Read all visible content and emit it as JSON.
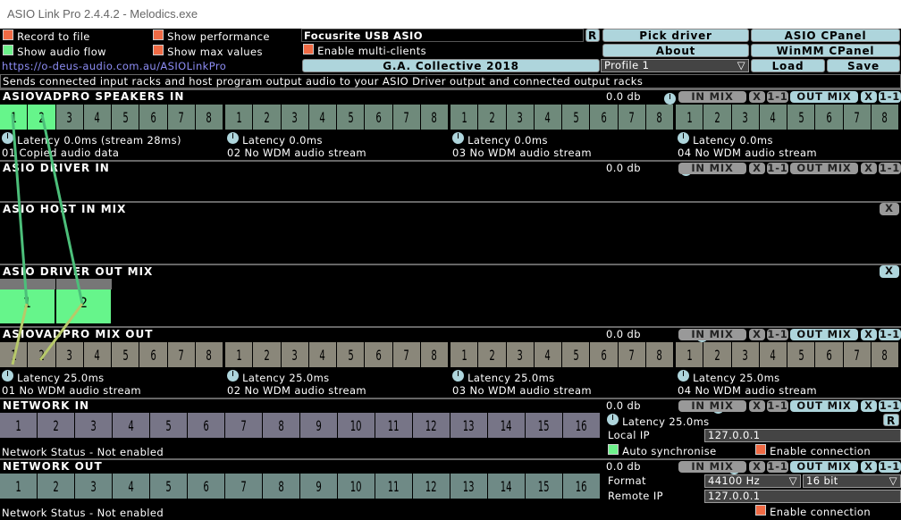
{
  "window": {
    "title": "ASIO Link Pro 2.4.4.2 - Melodics.exe"
  },
  "top": {
    "record_to_file": {
      "label": "Record to file",
      "checked": false
    },
    "show_audio_flow": {
      "label": "Show audio flow",
      "checked": true
    },
    "show_performance": {
      "label": "Show performance",
      "checked": false
    },
    "show_max_values": {
      "label": "Show max values",
      "checked": false
    },
    "link": "https://o-deus-audio.com.au/ASIOLinkPro",
    "driver_name": "Focusrite USB ASIO",
    "reset_label": "R",
    "enable_multi_clients": {
      "label": "Enable multi-clients",
      "checked": false
    },
    "license_label": "G.A. Collective 2018",
    "pick_driver": "Pick driver",
    "asio_cpanel": "ASIO CPanel",
    "about": "About",
    "winmm_cpanel": "WinMM CPanel",
    "profile": "Profile 1",
    "load": "Load",
    "save": "Save",
    "description": "Sends connected input racks and host program output audio to your ASIO Driver output and connected output racks"
  },
  "rack_controls": {
    "in_mix": "IN MIX",
    "out_mix": "OUT MIX",
    "x": "X",
    "one_to_one": "1-1",
    "db": "0.0 db"
  },
  "sections": {
    "speakers_in": {
      "title": "ASIOVADPRO SPEAKERS IN",
      "channels": [
        "1",
        "2",
        "3",
        "4",
        "5",
        "6",
        "7",
        "8"
      ],
      "active_channels": [
        1,
        2
      ],
      "groups": [
        {
          "latency": "Latency 0.0ms (stream 28ms)",
          "status": "01 Copied audio data"
        },
        {
          "latency": "Latency 0.0ms",
          "status": "02 No WDM audio stream"
        },
        {
          "latency": "Latency 0.0ms",
          "status": "03 No WDM audio stream"
        },
        {
          "latency": "Latency 0.0ms",
          "status": "04 No WDM audio stream"
        }
      ]
    },
    "driver_in": {
      "title": "ASIO DRIVER IN"
    },
    "host_in_mix": {
      "title": "ASIO HOST IN MIX"
    },
    "driver_out_mix": {
      "title": "ASIO DRIVER OUT MIX",
      "channels": [
        "1",
        "2"
      ]
    },
    "mix_out": {
      "title": "ASIOVADPRO MIX OUT",
      "channels": [
        "1",
        "2",
        "3",
        "4",
        "5",
        "6",
        "7",
        "8"
      ],
      "groups": [
        {
          "latency": "Latency 25.0ms",
          "status": "01 No WDM audio stream"
        },
        {
          "latency": "Latency 25.0ms",
          "status": "02 No WDM audio stream"
        },
        {
          "latency": "Latency 25.0ms",
          "status": "03 No WDM audio stream"
        },
        {
          "latency": "Latency 25.0ms",
          "status": "04 No WDM audio stream"
        }
      ]
    },
    "network_in": {
      "title": "NETWORK IN",
      "channels": [
        "1",
        "2",
        "3",
        "4",
        "5",
        "6",
        "7",
        "8",
        "9",
        "10",
        "11",
        "12",
        "13",
        "14",
        "15",
        "16"
      ],
      "status": "Network Status - Not enabled",
      "latency": "Latency 25.0ms",
      "reset_label": "R",
      "local_ip_label": "Local IP",
      "local_ip": "127.0.0.1",
      "auto_sync": {
        "label": "Auto synchronise",
        "checked": true
      },
      "enable_connection": {
        "label": "Enable connection",
        "checked": false
      }
    },
    "network_out": {
      "title": "NETWORK OUT",
      "channels": [
        "1",
        "2",
        "3",
        "4",
        "5",
        "6",
        "7",
        "8",
        "9",
        "10",
        "11",
        "12",
        "13",
        "14",
        "15",
        "16"
      ],
      "status": "Network Status - Not enabled",
      "format_label": "Format",
      "sample_rate": "44100 Hz",
      "bit_depth": "16 bit",
      "remote_ip_label": "Remote IP",
      "remote_ip": "127.0.0.1",
      "enable_connection": {
        "label": "Enable connection",
        "checked": false
      }
    }
  }
}
